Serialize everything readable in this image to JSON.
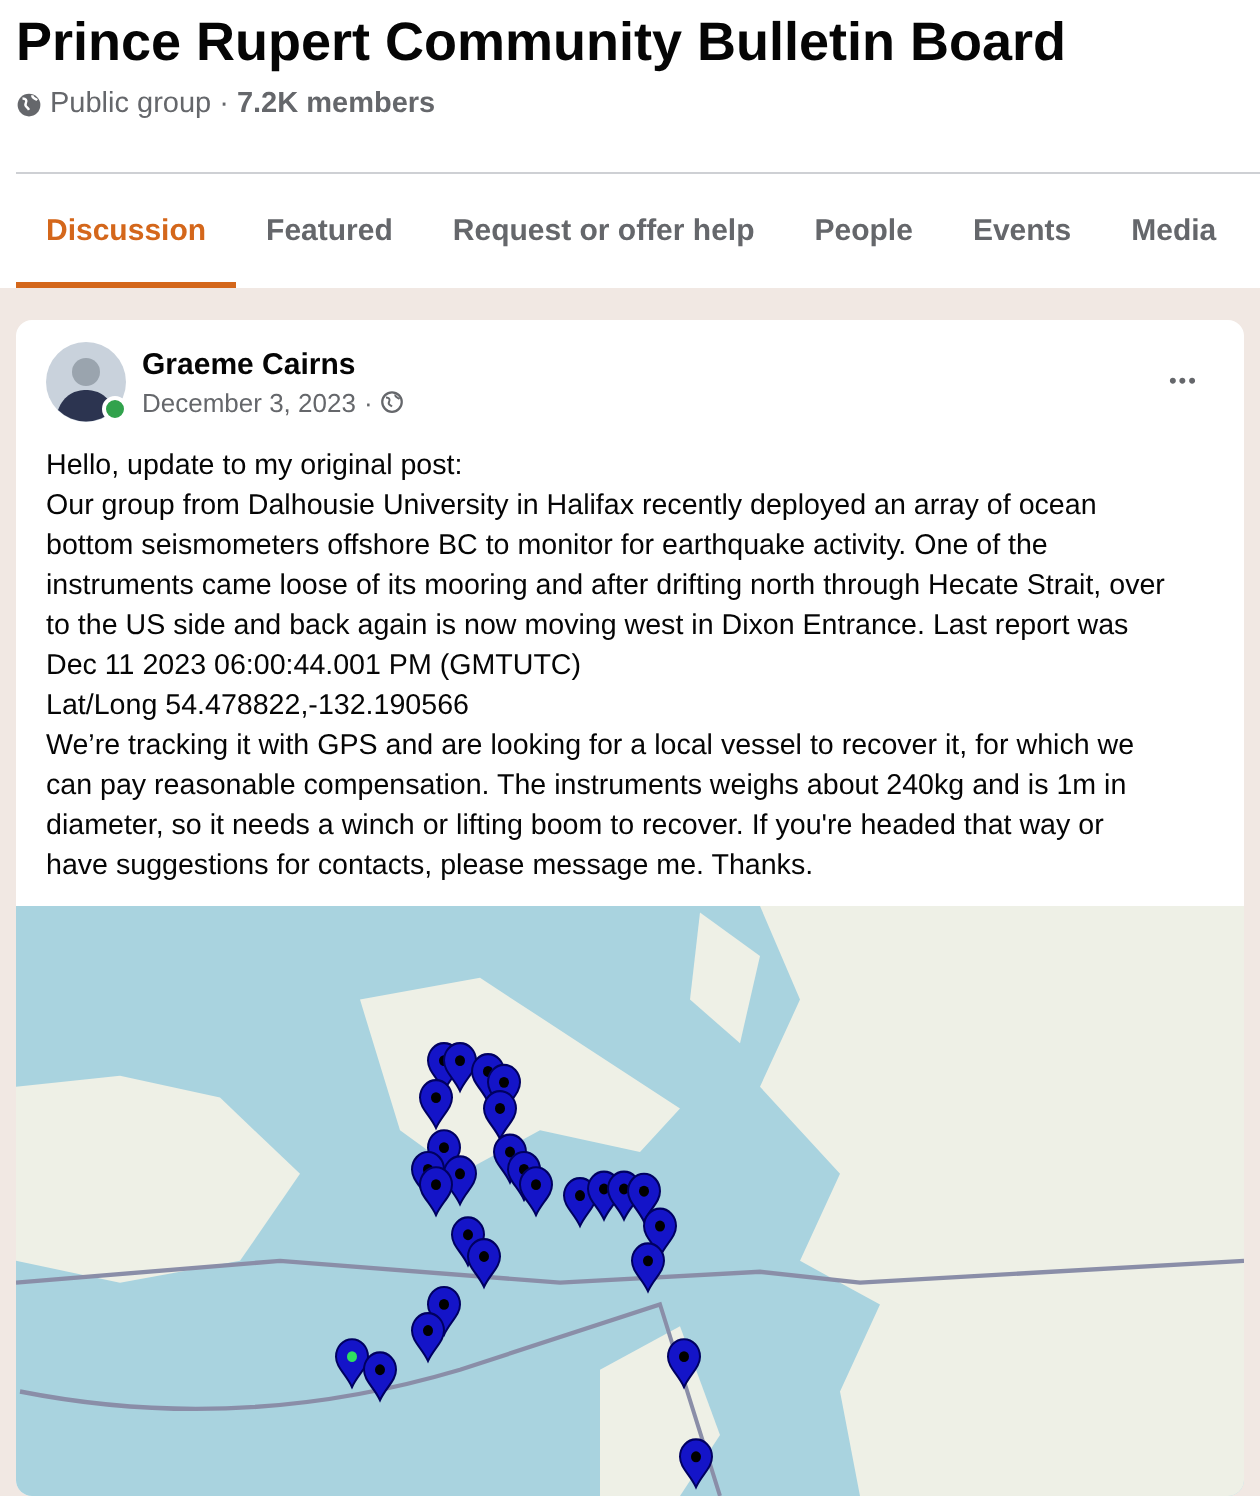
{
  "group": {
    "name": "Prince Rupert Community Bulletin Board",
    "privacy": "Public group",
    "separator": "·",
    "members": "7.2K members"
  },
  "tabs": [
    {
      "label": "Discussion",
      "selected": true
    },
    {
      "label": "Featured",
      "selected": false
    },
    {
      "label": "Request or offer help",
      "selected": false
    },
    {
      "label": "People",
      "selected": false
    },
    {
      "label": "Events",
      "selected": false
    },
    {
      "label": "Media",
      "selected": false
    }
  ],
  "post": {
    "author": "Graeme Cairns",
    "online": true,
    "date": "December 3, 2023",
    "separator": "·",
    "more": "•••",
    "body": [
      "Hello, update to my original post:",
      "Our group from Dalhousie University in Halifax recently deployed an array of ocean bottom seismometers offshore BC to monitor for earthquake activity. One of the instruments came loose of its mooring and after drifting north through Hecate Strait, over to the US side and back again is now moving west in Dixon Entrance. Last report was",
      "Dec 11 2023 06:00:44.001 PM (GMTUTC)",
      "Lat/Long 54.478822,-132.190566",
      "We’re tracking it with GPS and are looking for a local vessel to recover it, for which we can pay reasonable compensation. The instruments weighs about 240kg and is 1m in diameter, so it needs a winch or lifting boom to recover. If you're headed that way or have suggestions for contacts, please message me. Thanks."
    ]
  }
}
